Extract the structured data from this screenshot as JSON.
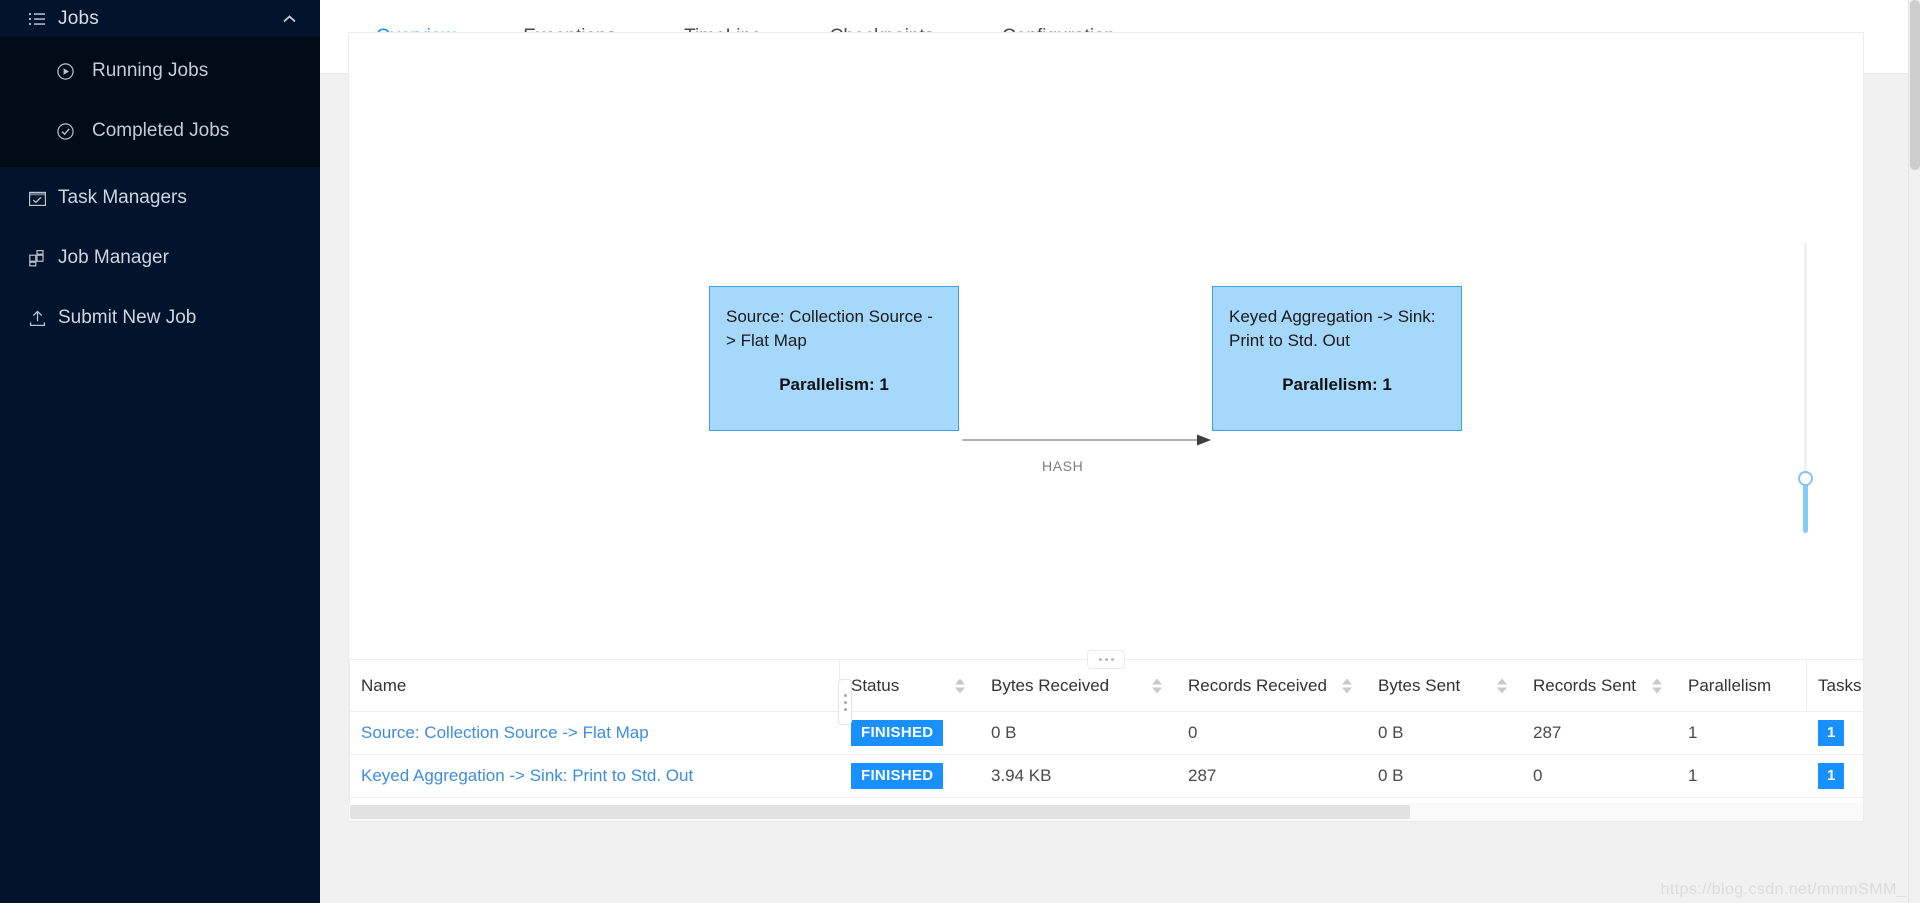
{
  "sidebar": {
    "group": {
      "icon": "list-icon",
      "label": "Jobs",
      "chevron": "chevron-up-icon",
      "children": [
        {
          "icon": "play-circle-icon",
          "label": "Running Jobs"
        },
        {
          "icon": "check-circle-icon",
          "label": "Completed Jobs"
        }
      ]
    },
    "items": [
      {
        "icon": "calendar-check-icon",
        "label": "Task Managers"
      },
      {
        "icon": "grid-icon",
        "label": "Job Manager"
      },
      {
        "icon": "upload-icon",
        "label": "Submit New Job"
      }
    ]
  },
  "tabs": [
    {
      "label": "Overview",
      "active": true
    },
    {
      "label": "Exceptions",
      "active": false
    },
    {
      "label": "TimeLine",
      "active": false
    },
    {
      "label": "Checkpoints",
      "active": false
    },
    {
      "label": "Configuration",
      "active": false
    }
  ],
  "graph": {
    "nodes": [
      {
        "title": "Source: Collection Source -> Flat Map",
        "parallelism_label": "Parallelism: 1"
      },
      {
        "title": "Keyed Aggregation -> Sink: Print to Std. Out",
        "parallelism_label": "Parallelism: 1"
      }
    ],
    "edges": [
      {
        "label": "HASH",
        "from": 0,
        "to": 1
      }
    ],
    "node_fill": "#a6d8fb",
    "node_border": "#3fa0ea",
    "zoom_slider": {
      "name": "graph-zoom-slider"
    },
    "resize_handle": {
      "name": "panel-resize-handle"
    }
  },
  "table": {
    "columns": [
      {
        "label": "Name",
        "sortable": false
      },
      {
        "label": "Status",
        "sortable": true
      },
      {
        "label": "Bytes Received",
        "sortable": true
      },
      {
        "label": "Records Received",
        "sortable": true
      },
      {
        "label": "Bytes Sent",
        "sortable": true
      },
      {
        "label": "Records Sent",
        "sortable": true
      },
      {
        "label": "Parallelism",
        "sortable": false
      },
      {
        "label": "Tasks",
        "sortable": false
      }
    ],
    "rows": [
      {
        "name": "Source: Collection Source -> Flat Map",
        "status": "FINISHED",
        "bytes_received": "0 B",
        "records_received": "0",
        "bytes_sent": "0 B",
        "records_sent": "287",
        "parallelism": "1",
        "tasks": "1"
      },
      {
        "name": "Keyed Aggregation -> Sink: Print to Std. Out",
        "status": "FINISHED",
        "bytes_received": "3.94 KB",
        "records_received": "287",
        "bytes_sent": "0 B",
        "records_sent": "0",
        "parallelism": "1",
        "tasks": "1"
      }
    ],
    "status_color": "#1890ff",
    "link_color": "#3e8ddd"
  },
  "watermark": "https://blog.csdn.net/mmmSMM_",
  "accent_color": "#1890ff"
}
